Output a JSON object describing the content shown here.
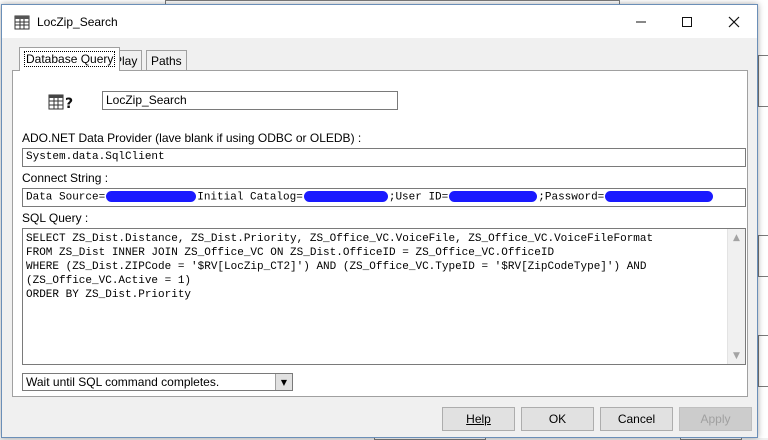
{
  "window": {
    "title": "LocZip_Search",
    "minimize": "—",
    "maximize": "☐",
    "close": "✕"
  },
  "tabs": [
    {
      "label": "Database Query",
      "active": true
    },
    {
      "label": "Play",
      "active": false
    },
    {
      "label": "Paths",
      "active": false
    }
  ],
  "query": {
    "name_value": "LocZip_Search",
    "provider_label": "ADO.NET Data Provider (lave blank if using ODBC or OLEDB) :",
    "provider_value": "System.data.SqlClient",
    "connect_label": "Connect String :",
    "connect_parts": {
      "p1": "Data Source=",
      "p2": "Initial Catalog=",
      "p3": ";User ID=",
      "p4": ";Password="
    },
    "sql_label": "SQL Query :",
    "sql_text": "SELECT ZS_Dist.Distance, ZS_Dist.Priority, ZS_Office_VC.VoiceFile, ZS_Office_VC.VoiceFileFormat\nFROM ZS_Dist INNER JOIN ZS_Office_VC ON ZS_Dist.OfficeID = ZS_Office_VC.OfficeID\nWHERE (ZS_Dist.ZIPCode = '$RV[LocZip_CT2]') AND (ZS_Office_VC.TypeID = '$RV[ZipCodeType]') AND\n(ZS_Office_VC.Active = 1)\nORDER BY ZS_Dist.Priority",
    "wait_option": "Wait until SQL command completes."
  },
  "buttons": {
    "help": "Help",
    "ok": "OK",
    "cancel": "Cancel",
    "apply": "Apply"
  },
  "icons": {
    "title": "grid-document-icon",
    "query": "database-query-icon"
  },
  "colors": {
    "redaction": "#1a1aff",
    "title_bg": "#ffffff",
    "dialog_bg": "#f0f0f0"
  }
}
